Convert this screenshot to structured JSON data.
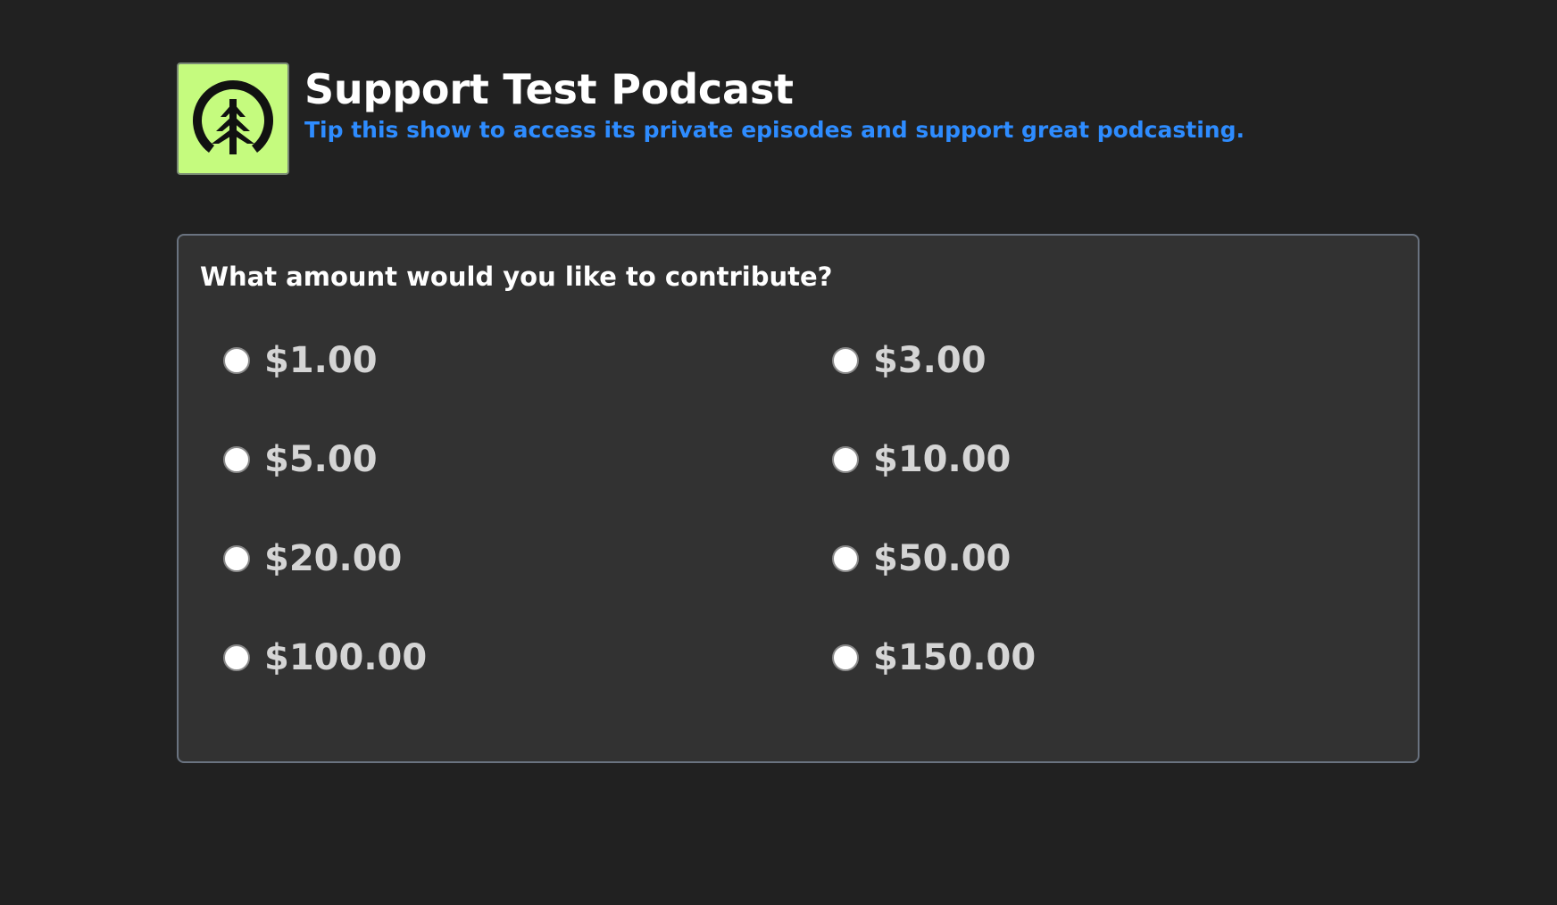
{
  "header": {
    "title": "Support Test Podcast",
    "subtitle": "Tip this show to access its private episodes and support great podcasting.",
    "logo_icon": "tree-logo-icon",
    "logo_background": "#c5fb7e"
  },
  "form": {
    "question": "What amount would you like to contribute?",
    "options": [
      {
        "label": "$1.00",
        "selected": false
      },
      {
        "label": "$3.00",
        "selected": false
      },
      {
        "label": "$5.00",
        "selected": false
      },
      {
        "label": "$10.00",
        "selected": false
      },
      {
        "label": "$20.00",
        "selected": false
      },
      {
        "label": "$50.00",
        "selected": false
      },
      {
        "label": "$100.00",
        "selected": false
      },
      {
        "label": "$150.00",
        "selected": false
      }
    ]
  },
  "colors": {
    "background": "#212121",
    "card": "#323232",
    "accent": "#2e8cff"
  }
}
